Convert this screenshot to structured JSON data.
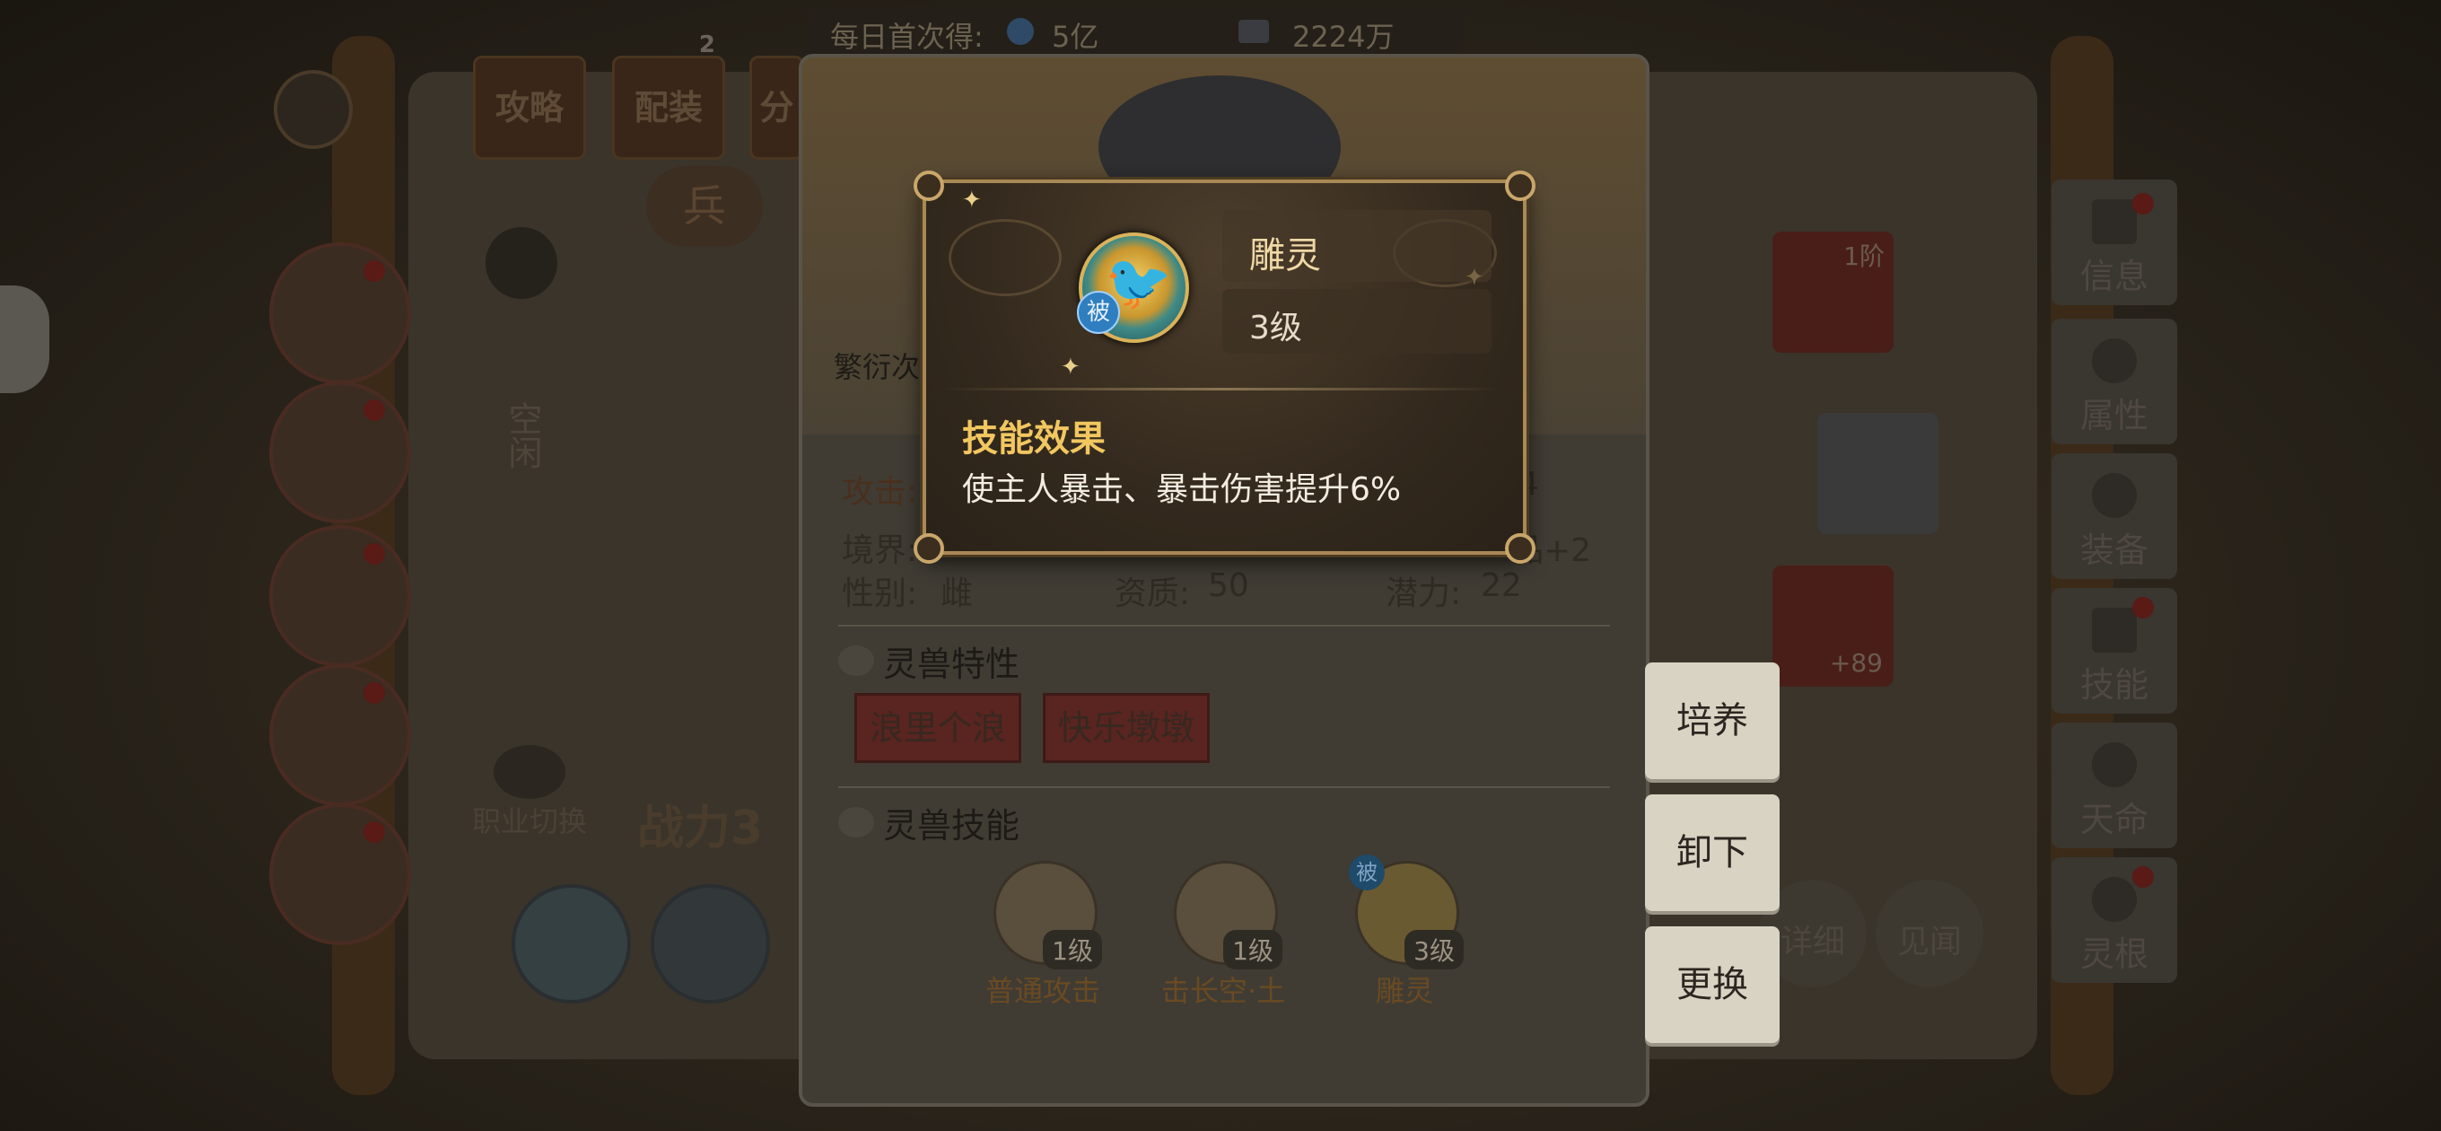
{
  "top_bar": {
    "first_daily_label": "每日首次得:",
    "first_daily_value": "5亿",
    "currency_value": "2224万"
  },
  "left_tabs": [
    "攻略",
    "配装",
    "分"
  ],
  "left_tab_badge": "2",
  "left_labels": {
    "troops": "兵",
    "idle": "空闲",
    "switch_job": "职业切换",
    "combat_power": "战力3"
  },
  "right_tabs": [
    "信息",
    "属性",
    "装备",
    "技能",
    "天命",
    "灵根"
  ],
  "right_card_badge": "1阶",
  "right_card_plus": "+89",
  "side_buttons": [
    "培养",
    "卸下",
    "更换"
  ],
  "bottom_right_circles": [
    "详细",
    "见闻"
  ],
  "panel": {
    "breeding_label": "繁衍次",
    "stats": {
      "attack_label": "攻击:",
      "attack_value": "724",
      "realm_label": "境界:",
      "realm_value": "品+2",
      "gender_label": "性别:",
      "gender_value": "雌",
      "aptitude_label": "资质:",
      "aptitude_value": "50",
      "potential_label": "潜力:",
      "potential_value": "22"
    },
    "traits_title": "灵兽特性",
    "traits": [
      "浪里个浪",
      "快乐墩墩"
    ],
    "skills_title": "灵兽技能",
    "skills": [
      {
        "name": "普通攻击",
        "level": "1级"
      },
      {
        "name": "击长空·土",
        "level": "1级"
      },
      {
        "name": "雕灵",
        "level": "3级",
        "badge": "被"
      }
    ]
  },
  "tooltip": {
    "skill_name": "雕灵",
    "skill_level": "3级",
    "passive_badge": "被",
    "effect_title": "技能效果",
    "effect_desc": "使主人暴击、暴击伤害提升6%"
  },
  "colors": {
    "tooltip_title": "#f2c760",
    "tooltip_border": "#a88855",
    "trait_fill": "#5a2420"
  }
}
